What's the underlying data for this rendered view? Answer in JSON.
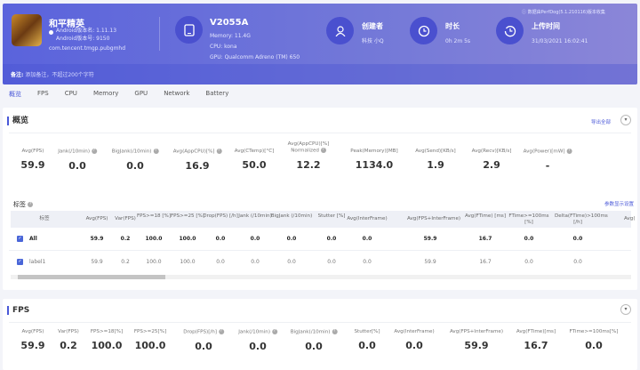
{
  "header": {
    "app_name": "和平精英",
    "android_version_name": "Android版本名: 1.11.13",
    "android_version_code": "Android版本号: 9150",
    "package": "com.tencent.tmgp.pubgmhd",
    "device": "V2055A",
    "memory": "Memory: 11.4G",
    "cpu": "CPU: kona",
    "gpu": "GPU: Qualcomm Adreno (TM) 650",
    "creator_label": "创建者",
    "creator": "科技 小Q",
    "duration_label": "时长",
    "duration": "0h 2m 5s",
    "upload_label": "上传时间",
    "upload_time": "31/03/2021 16:02:41",
    "source": "数据由PerfDog(5.1.210116)版本收集",
    "note_label": "备注:",
    "note_placeholder": "添加备注，不超过200个字符"
  },
  "tabs": [
    "概览",
    "FPS",
    "CPU",
    "Memory",
    "GPU",
    "Network",
    "Battery"
  ],
  "overview": {
    "title": "概览",
    "export": "导出全部",
    "metrics": [
      {
        "label": "Avg(FPS)",
        "value": "59.9"
      },
      {
        "label": "Jank(/10min)",
        "value": "0.0",
        "help": true
      },
      {
        "label": "BigJank(/10min)",
        "value": "0.0",
        "help": true
      },
      {
        "label": "Avg(AppCPU)[%]",
        "value": "16.9",
        "help": true
      },
      {
        "label": "Avg(CTemp)[°C]",
        "value": "50.0"
      },
      {
        "label": "Avg(AppCPU)[%] Normalized",
        "value": "12.2",
        "help": true
      },
      {
        "label": "Peak(Memory)[MB]",
        "value": "1134.0"
      },
      {
        "label": "Avg(Send)[KB/s]",
        "value": "1.9"
      },
      {
        "label": "Avg(Recv)[KB/s]",
        "value": "2.9"
      },
      {
        "label": "Avg(Power)[mW]",
        "value": "-",
        "help": true
      }
    ]
  },
  "labels": {
    "title": "标签",
    "settings": "参数显示设置",
    "columns": [
      "标签",
      "Avg(FPS)",
      "Var(FPS)",
      "FPS>=18 [%]",
      "FPS>=25 [%]",
      "Drop(FPS) [/h]",
      "Jank (/10min)",
      "BigJank (/10min)",
      "Stutter [%]",
      "Avg(InterFrame)",
      "Avg(FPS+InterFrame)",
      "Avg(FTime) [ms]",
      "FTime>=100ms [%]",
      "Delta(FTime)>100ms [/h]",
      "Avg("
    ],
    "rows": [
      [
        "All",
        "59.9",
        "0.2",
        "100.0",
        "100.0",
        "0.0",
        "0.0",
        "0.0",
        "0.0",
        "0.0",
        "59.9",
        "16.7",
        "0.0",
        "0.0"
      ],
      [
        "label1",
        "59.9",
        "0.2",
        "100.0",
        "100.0",
        "0.0",
        "0.0",
        "0.0",
        "0.0",
        "0.0",
        "59.9",
        "16.7",
        "0.0",
        "0.0"
      ]
    ]
  },
  "fps": {
    "title": "FPS",
    "metrics": [
      {
        "label": "Avg(FPS)",
        "value": "59.9"
      },
      {
        "label": "Var(FPS)",
        "value": "0.2"
      },
      {
        "label": "FPS>=18[%]",
        "value": "100.0"
      },
      {
        "label": "FPS>=25[%]",
        "value": "100.0"
      },
      {
        "label": "Drop(FPS)[/h]",
        "value": "0.0",
        "help": true
      },
      {
        "label": "Jank(/10min)",
        "value": "0.0",
        "help": true
      },
      {
        "label": "BigJank(/10min)",
        "value": "0.0",
        "help": true
      },
      {
        "label": "Stutter[%]",
        "value": "0.0"
      },
      {
        "label": "Avg(InterFrame)",
        "value": "0.0"
      },
      {
        "label": "Avg(FPS+InterFrame)",
        "value": "59.9"
      },
      {
        "label": "Avg(FTime)[ms]",
        "value": "16.7"
      },
      {
        "label": "FTime>=100ms[%]",
        "value": "0.0"
      }
    ]
  }
}
